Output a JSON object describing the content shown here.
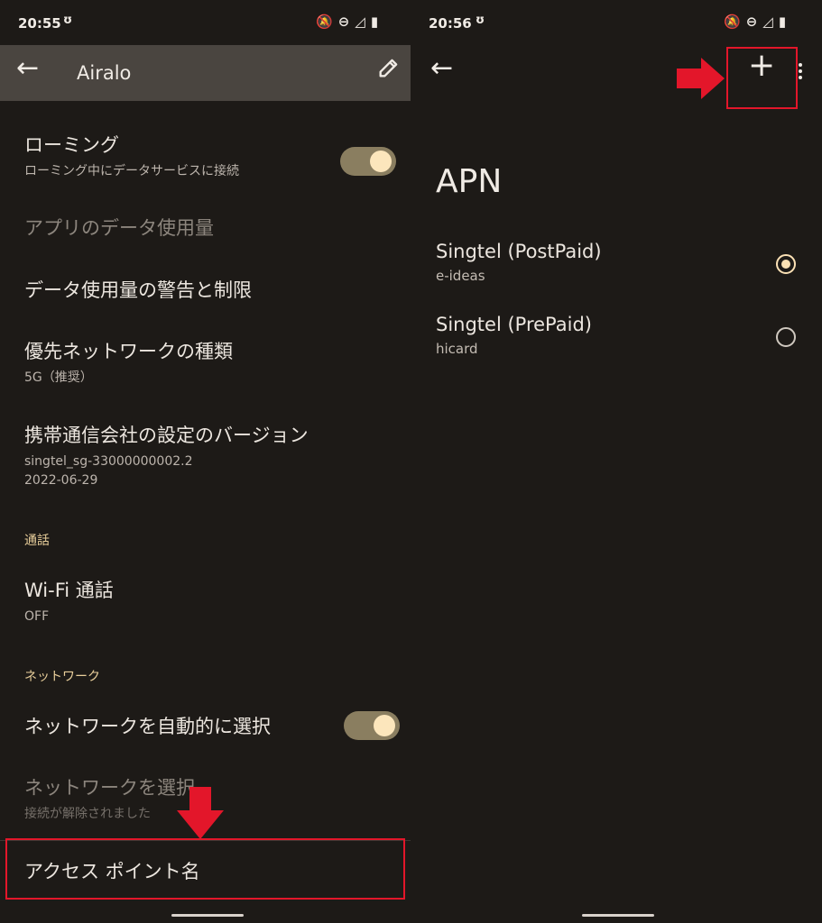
{
  "left": {
    "status": {
      "time": "20:55"
    },
    "appbar": {
      "title": "Airalo"
    },
    "rows": {
      "roaming": {
        "title": "ローミング",
        "sub": "ローミング中にデータサービスに接続"
      },
      "app_data": {
        "title": "アプリのデータ使用量"
      },
      "data_warning": {
        "title": "データ使用量の警告と制限"
      },
      "pref_network": {
        "title": "優先ネットワークの種類",
        "sub": "5G（推奨）"
      },
      "carrier": {
        "title": "携帯通信会社の設定のバージョン",
        "sub1": "singtel_sg-33000000002.2",
        "sub2": "2022-06-29"
      },
      "wifi_calling": {
        "title": "Wi-Fi 通話",
        "sub": "OFF"
      },
      "auto_network": {
        "title": "ネットワークを自動的に選択"
      },
      "choose_network": {
        "title": "ネットワークを選択",
        "sub": "接続が解除されました"
      },
      "apn": {
        "title": "アクセス ポイント名"
      }
    },
    "headers": {
      "calls": "通話",
      "network": "ネットワーク"
    },
    "toggles": {
      "roaming": true,
      "auto_network": true
    }
  },
  "right": {
    "status": {
      "time": "20:56"
    },
    "page_title": "APN",
    "apns": [
      {
        "name": "Singtel (PostPaid)",
        "apn": "e-ideas",
        "selected": true
      },
      {
        "name": "Singtel (PrePaid)",
        "apn": "hicard",
        "selected": false
      }
    ],
    "add_label": "+"
  },
  "colors": {
    "accent": "#fbe1b5",
    "highlight_red": "#e3162a",
    "appbar": "#4a4540",
    "background": "#1d1a17"
  }
}
